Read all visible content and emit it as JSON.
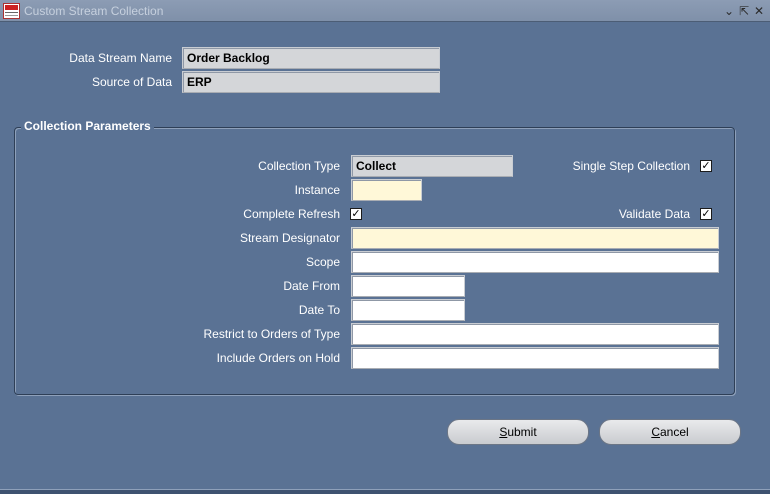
{
  "window": {
    "title": "Custom Stream Collection",
    "controls": {
      "minimize_glyph": "⌄",
      "maximize_glyph": "⇱",
      "close_glyph": "✕"
    }
  },
  "header": {
    "data_stream_name_label": "Data Stream Name",
    "data_stream_name_value": "Order Backlog",
    "source_of_data_label": "Source of Data",
    "source_of_data_value": "ERP"
  },
  "collection": {
    "group_title": "Collection Parameters",
    "collection_type_label": "Collection Type",
    "collection_type_value": "Collect",
    "single_step_label": "Single Step Collection",
    "single_step_checked": "✓",
    "instance_label": "Instance",
    "instance_value": "",
    "complete_refresh_label": "Complete Refresh",
    "complete_refresh_checked": "✓",
    "validate_data_label": "Validate Data",
    "validate_data_checked": "✓",
    "stream_designator_label": "Stream Designator",
    "stream_designator_value": "",
    "scope_label": "Scope",
    "scope_value": "",
    "date_from_label": "Date From",
    "date_from_value": "",
    "date_to_label": "Date To",
    "date_to_value": "",
    "restrict_orders_label": "Restrict to Orders of Type",
    "restrict_orders_value": "",
    "include_on_hold_label": "Include Orders on Hold",
    "include_on_hold_value": ""
  },
  "buttons": {
    "submit_mnemonic": "S",
    "submit_rest": "ubmit",
    "cancel_mnemonic": "C",
    "cancel_rest": "ancel"
  },
  "colors": {
    "background": "#5a7294",
    "required_field": "#fff8d8",
    "readonly_field": "#d4d6d9"
  }
}
